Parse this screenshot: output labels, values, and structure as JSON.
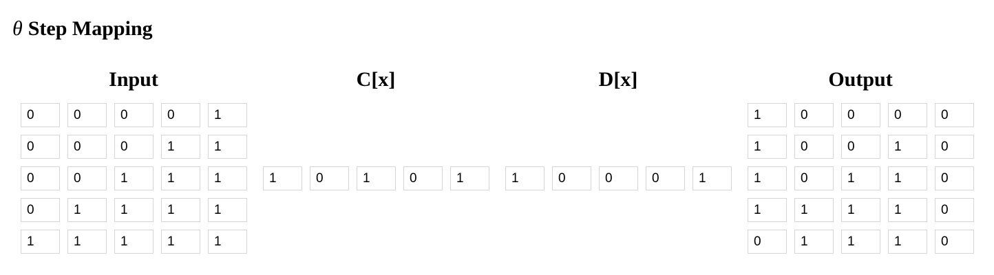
{
  "page": {
    "title_symbol": "θ",
    "title_text": "Step Mapping"
  },
  "sections": {
    "input": {
      "header": "Input",
      "rows": [
        [
          "0",
          "0",
          "0",
          "0",
          "1"
        ],
        [
          "0",
          "0",
          "0",
          "1",
          "1"
        ],
        [
          "0",
          "0",
          "1",
          "1",
          "1"
        ],
        [
          "0",
          "1",
          "1",
          "1",
          "1"
        ],
        [
          "1",
          "1",
          "1",
          "1",
          "1"
        ]
      ]
    },
    "c": {
      "header": "C[x]",
      "values": [
        "1",
        "0",
        "1",
        "0",
        "1"
      ]
    },
    "d": {
      "header": "D[x]",
      "values": [
        "1",
        "0",
        "0",
        "0",
        "1"
      ]
    },
    "output": {
      "header": "Output",
      "rows": [
        [
          "1",
          "0",
          "0",
          "0",
          "0"
        ],
        [
          "1",
          "0",
          "0",
          "1",
          "0"
        ],
        [
          "1",
          "0",
          "1",
          "1",
          "0"
        ],
        [
          "1",
          "1",
          "1",
          "1",
          "0"
        ],
        [
          "0",
          "1",
          "1",
          "1",
          "0"
        ]
      ]
    }
  }
}
